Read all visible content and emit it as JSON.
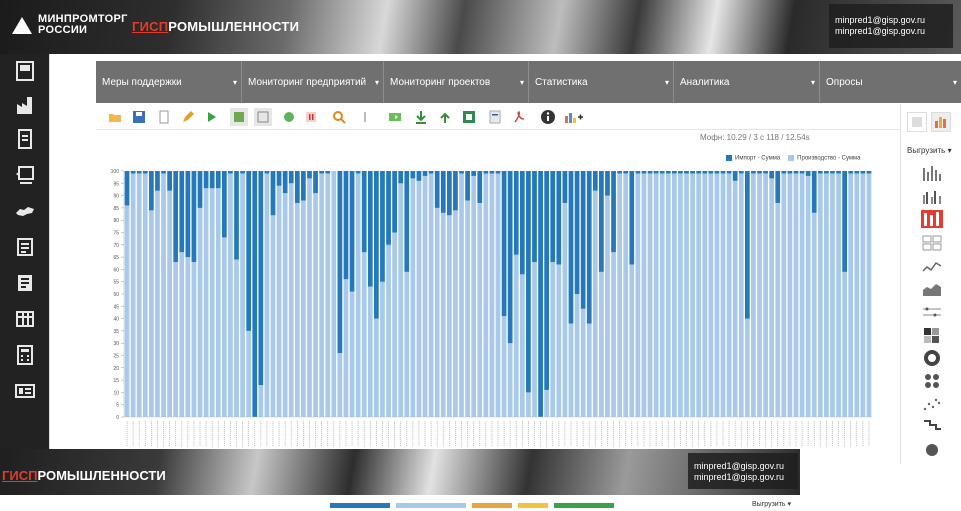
{
  "header": {
    "logo_line1": "МИНПРОМТОРГ",
    "logo_line2": "РОССИИ",
    "gisp_red": "ГИСП",
    "gisp_rest": "РОМЫШЛЕННОСТИ",
    "user_line1": "minpred1@gisp.gov.ru",
    "user_line2": "minpred1@gisp.gov.ru"
  },
  "nav": [
    {
      "label": "Меры поддержки"
    },
    {
      "label": "Мониторинг предприятий"
    },
    {
      "label": "Мониторинг проектов"
    },
    {
      "label": "Статистика"
    },
    {
      "label": "Аналитика"
    },
    {
      "label": "Опросы"
    }
  ],
  "stats": "Мофн: 10.29 / 3 с 118 / 12.54s",
  "right_panel": {
    "export_label": "Выгрузить"
  },
  "chart_data": {
    "type": "bar",
    "stacked": true,
    "ylim": [
      0,
      100
    ],
    "yticks": [
      0,
      5,
      10,
      15,
      20,
      25,
      30,
      35,
      40,
      45,
      50,
      55,
      60,
      65,
      70,
      75,
      80,
      85,
      90,
      95,
      100
    ],
    "legend": [
      {
        "name": "Импорт - Сумма",
        "color": "#2479bd"
      },
      {
        "name": "Производство - Сумма",
        "color": "#a8c9ea"
      }
    ],
    "series": [
      {
        "name": "Производство - Сумма",
        "values": [
          86,
          99,
          99,
          99,
          84,
          92,
          99,
          92,
          63,
          67,
          65,
          63,
          85,
          93,
          93,
          93,
          73,
          99,
          64,
          99,
          35,
          0,
          13,
          99,
          82,
          94,
          91,
          95,
          87,
          88,
          97,
          91,
          99,
          99,
          100,
          26,
          56,
          51,
          99,
          67,
          53,
          40,
          55,
          70,
          75,
          95,
          59,
          97,
          96,
          98,
          99,
          85,
          83,
          82,
          84,
          99,
          88,
          98,
          87,
          99,
          99,
          99,
          41,
          30,
          66,
          58,
          10,
          63,
          0,
          11,
          63,
          62,
          87,
          38,
          50,
          44,
          38,
          92,
          59,
          90,
          67,
          99,
          99,
          62,
          99,
          99,
          99,
          99,
          99,
          99,
          99,
          99,
          99,
          99,
          99,
          99,
          99,
          99,
          99,
          99,
          96,
          99,
          40,
          99,
          99,
          99,
          97,
          87,
          99,
          99,
          99,
          99,
          98,
          83,
          99,
          99,
          99,
          99,
          59,
          99,
          99,
          99,
          99
        ]
      },
      {
        "name": "Импорт - Сумма",
        "values": [
          14,
          1,
          1,
          1,
          16,
          8,
          1,
          8,
          37,
          33,
          35,
          37,
          15,
          7,
          7,
          7,
          27,
          1,
          36,
          1,
          65,
          100,
          87,
          1,
          18,
          6,
          9,
          5,
          13,
          12,
          3,
          9,
          1,
          1,
          0,
          74,
          44,
          49,
          1,
          33,
          47,
          60,
          45,
          30,
          25,
          5,
          41,
          3,
          4,
          2,
          1,
          15,
          17,
          18,
          16,
          1,
          12,
          2,
          13,
          1,
          1,
          1,
          59,
          70,
          34,
          42,
          90,
          37,
          100,
          89,
          37,
          38,
          13,
          62,
          50,
          56,
          62,
          8,
          41,
          10,
          33,
          1,
          1,
          38,
          1,
          1,
          1,
          1,
          1,
          1,
          1,
          1,
          1,
          1,
          1,
          1,
          1,
          1,
          1,
          1,
          4,
          1,
          60,
          1,
          1,
          1,
          3,
          13,
          1,
          1,
          1,
          1,
          2,
          17,
          1,
          1,
          1,
          1,
          41,
          1,
          1,
          1,
          1
        ]
      }
    ]
  },
  "dup": {
    "gisp_red": "ГИСП",
    "gisp_rest": "РОМЫШЛЕННОСТИ",
    "user_line1": "minpred1@gisp.gov.ru",
    "user_line2": "minpred1@gisp.gov.ru",
    "export_label": "Выгрузить"
  },
  "colors": {
    "nav_bg": "#707070",
    "import": "#2479bd",
    "production": "#a8c9ea",
    "accent_red": "#e23a2c"
  }
}
